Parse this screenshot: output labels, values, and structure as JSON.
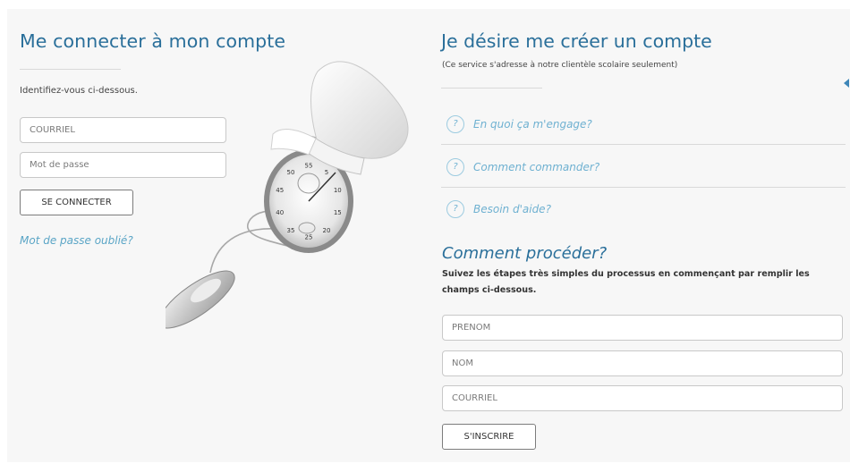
{
  "login": {
    "title": "Me connecter à mon compte",
    "intro": "Identifiez-vous ci-dessous.",
    "email_placeholder": "COURRIEL",
    "password_placeholder": "Mot de passe",
    "submit_label": "SE CONNECTER",
    "forgot_label": "Mot de passe oublié?"
  },
  "signup": {
    "title": "Je désire me créer un compte",
    "subtitle": "(Ce service s'adresse à notre clientèle scolaire seulement)",
    "faq": [
      {
        "icon": "?",
        "label": "En quoi ça m'engage?"
      },
      {
        "icon": "?",
        "label": "Comment commander?"
      },
      {
        "icon": "?",
        "label": "Besoin d'aide?"
      }
    ],
    "how_title": "Comment procéder?",
    "how_description": "Suivez les étapes très simples du processus en commençant par remplir les champs ci-dessous.",
    "firstname_placeholder": "PRÉNOM",
    "lastname_placeholder": "NOM",
    "email_placeholder": "COURRIEL",
    "submit_label": "S'INSCRIRE"
  },
  "illustration": {
    "stopwatch_numbers": [
      "55",
      "5",
      "10",
      "15",
      "20",
      "25",
      "35",
      "40",
      "45",
      "50"
    ]
  },
  "colors": {
    "heading": "#2a6f9a",
    "link": "#6fb1d1",
    "panel": "#f7f7f7"
  }
}
